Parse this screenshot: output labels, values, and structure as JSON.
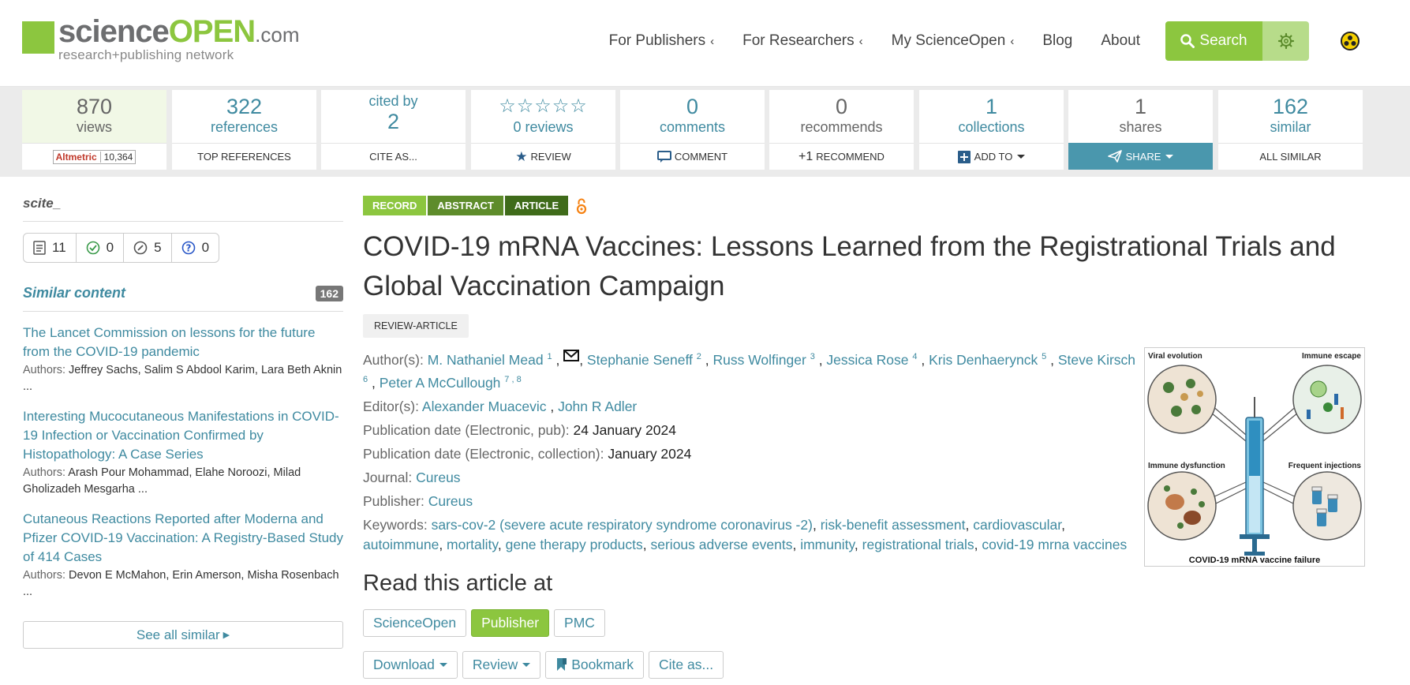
{
  "brand": {
    "logo_main_science": "science",
    "logo_main_open": "OPEN",
    "logo_main_com": ".com",
    "logo_sub": "research+publishing network",
    "accent": "#8cc63f",
    "link": "#3f8aa0"
  },
  "nav": {
    "items": [
      {
        "label": "For Publishers",
        "chevron": "‹"
      },
      {
        "label": "For Researchers",
        "chevron": "‹"
      },
      {
        "label": "My ScienceOpen",
        "chevron": "‹"
      },
      {
        "label": "Blog"
      },
      {
        "label": "About"
      }
    ],
    "search_label": "Search",
    "gear_icon": "gear-icon",
    "user_icon": "user-circle-icon"
  },
  "metrics": [
    {
      "num": "870",
      "label": "views",
      "action": "10,364",
      "action_prefix": "Altmetric"
    },
    {
      "num": "322",
      "label": "references",
      "action": "TOP REFERENCES"
    },
    {
      "num": "2",
      "label": "cited by",
      "action": "CITE AS..."
    },
    {
      "stars": "☆☆☆☆☆",
      "label": "0 reviews",
      "action": "REVIEW"
    },
    {
      "num": "0",
      "label": "comments",
      "action": "COMMENT"
    },
    {
      "num": "0",
      "label": "recommends",
      "action": "RECOMMEND",
      "action_prefix": "+1"
    },
    {
      "num": "1",
      "label": "collections",
      "action": "ADD TO"
    },
    {
      "num": "1",
      "label": "shares",
      "action": "SHARE"
    },
    {
      "num": "162",
      "label": "similar",
      "action": "ALL SIMILAR"
    }
  ],
  "sidebar": {
    "scite_logo": "scite_",
    "scite": {
      "mentions": "11",
      "supporting": "0",
      "mentioning": "5",
      "contrasting": "0"
    },
    "similar_title": "Similar content",
    "similar_count": "162",
    "authors_label": "Authors:",
    "items": [
      {
        "title": "The Lancet Commission on lessons for the future from the COVID-19 pandemic",
        "authors": "Jeffrey Sachs, Salim S Abdool Karim, Lara Beth Aknin",
        "more": "..."
      },
      {
        "title": "Interesting Mucocutaneous Manifestations in COVID-19 Infection or Vaccination Confirmed by Histopathology: A Case Series",
        "authors": "Arash Pour Mohammad, Elahe Noroozi, Milad Gholizadeh Mesgarha ...",
        "more": ""
      },
      {
        "title": "Cutaneous Reactions Reported after Moderna and Pfizer COVID-19 Vaccination: A Registry-Based Study of 414 Cases",
        "authors": "Devon E McMahon, Erin Amerson, Misha Rosenbach",
        "more": "..."
      }
    ],
    "see_all": "See all similar"
  },
  "article": {
    "tags": [
      "RECORD",
      "ABSTRACT",
      "ARTICLE"
    ],
    "title": "COVID-19 mRNA Vaccines: Lessons Learned from the Registrational Trials and Global Vaccination Campaign",
    "review_badge": "REVIEW-ARTICLE",
    "authors_label": "Author(s):",
    "authors": [
      {
        "name": "M. Nathaniel Mead",
        "sup": "1",
        "email": true
      },
      {
        "name": "Stephanie Seneff",
        "sup": "2"
      },
      {
        "name": "Russ Wolfinger",
        "sup": "3"
      },
      {
        "name": "Jessica Rose",
        "sup": "4"
      },
      {
        "name": "Kris Denhaerynck",
        "sup": "5"
      },
      {
        "name": "Steve Kirsch",
        "sup": "6"
      },
      {
        "name": "Peter A McCullough",
        "sup": "7 , 8"
      }
    ],
    "editors_label": "Editor(s):",
    "editors": [
      "Alexander Muacevic",
      "John R Adler"
    ],
    "pubdate_pub_label": "Publication date (Electronic, pub):",
    "pubdate_pub": "24 January 2024",
    "pubdate_coll_label": "Publication date (Electronic, collection):",
    "pubdate_coll": "January 2024",
    "journal_label": "Journal:",
    "journal": "Cureus",
    "publisher_label": "Publisher:",
    "publisher": "Cureus",
    "keywords_label": "Keywords:",
    "keywords": [
      "sars-cov-2 (severe acute respiratory syndrome coronavirus -2)",
      "risk-benefit assessment",
      "cardiovascular",
      "autoimmune",
      "mortality",
      "gene therapy products",
      "serious adverse events",
      "immunity",
      "registrational trials",
      "covid-19 mrna vaccines"
    ],
    "figure": {
      "labels": [
        "Viral evolution",
        "Immune escape",
        "Immune dysfunction",
        "Frequent injections"
      ],
      "caption": "COVID-19 mRNA vaccine failure"
    },
    "read_head": "Read this article at",
    "read_buttons": [
      "ScienceOpen",
      "Publisher",
      "PMC"
    ],
    "action_buttons": [
      "Download",
      "Review",
      "Bookmark",
      "Cite as..."
    ]
  }
}
